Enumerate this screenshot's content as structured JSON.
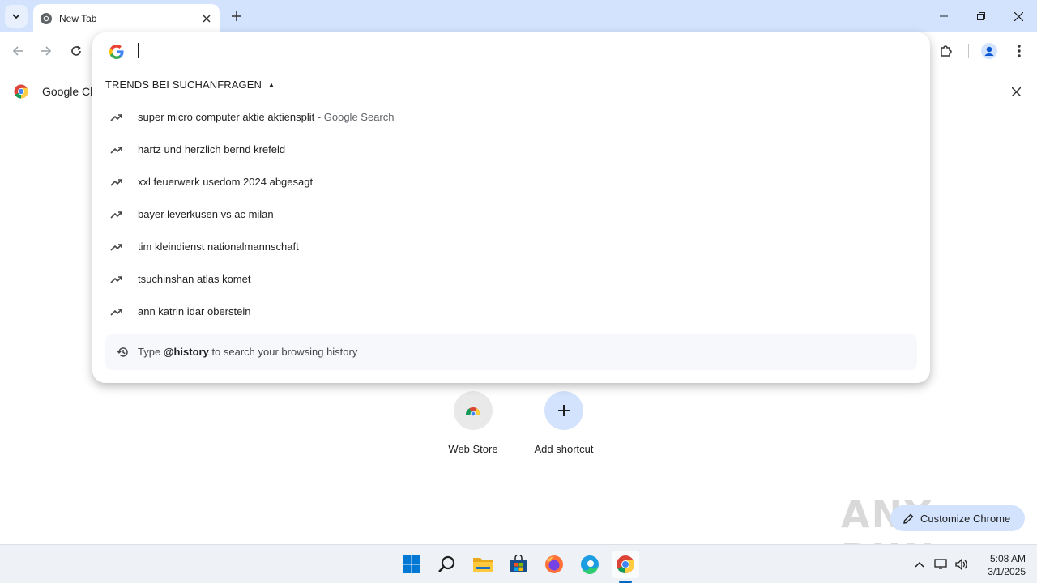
{
  "browser": {
    "tab": {
      "title": "New Tab"
    },
    "infobar": {
      "text": "Google Ch"
    }
  },
  "omnibox": {
    "input_value": "",
    "trends_heading": "TRENDS BEI SUCHANFRAGEN",
    "suggestions": [
      {
        "text": "super micro computer aktie aktiensplit",
        "suffix": " - Google Search"
      },
      {
        "text": "hartz und herzlich bernd krefeld",
        "suffix": ""
      },
      {
        "text": "xxl feuerwerk usedom 2024 abgesagt",
        "suffix": ""
      },
      {
        "text": "bayer leverkusen vs ac milan",
        "suffix": ""
      },
      {
        "text": "tim kleindienst nationalmannschaft",
        "suffix": ""
      },
      {
        "text": "tsuchinshan atlas komet",
        "suffix": ""
      },
      {
        "text": "ann katrin idar oberstein",
        "suffix": ""
      }
    ],
    "history_hint": {
      "prefix": "Type ",
      "keyword": "@history",
      "suffix": " to search your browsing history"
    }
  },
  "ntp": {
    "shortcuts": [
      {
        "label": "Web Store",
        "icon": "chrome-web-store-icon"
      },
      {
        "label": "Add shortcut",
        "icon": "plus-icon"
      }
    ],
    "customize_label": "Customize Chrome"
  },
  "watermark": "ANY RUN",
  "taskbar": {
    "time": "5:08 AM",
    "date": "3/1/2025",
    "apps": [
      "start-icon",
      "search-icon",
      "file-explorer-icon",
      "store-icon",
      "firefox-icon",
      "edge-icon",
      "chrome-icon"
    ]
  },
  "colors": {
    "titlebar": "#d3e3fd",
    "accent": "#0b57d0",
    "taskbar": "#eef1f6"
  }
}
